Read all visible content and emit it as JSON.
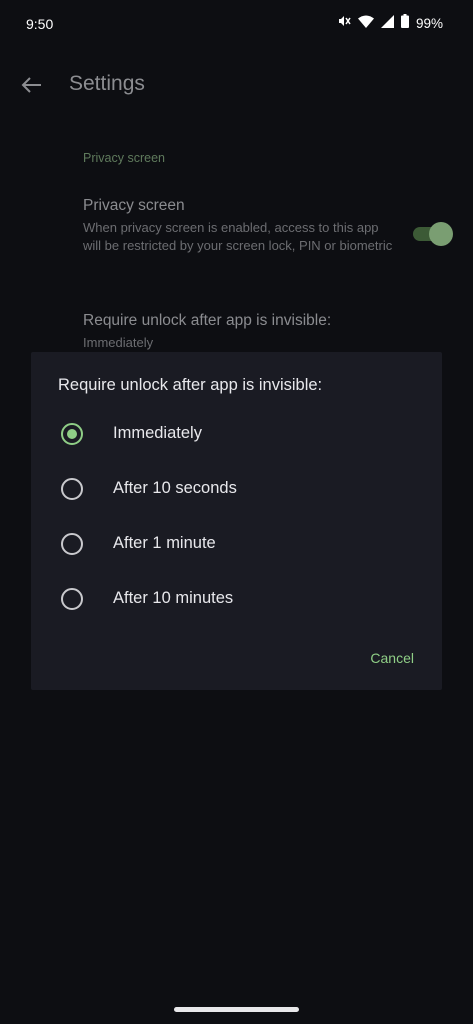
{
  "status_bar": {
    "time": "9:50",
    "battery": "99%",
    "icons": [
      "mute-icon",
      "wifi-icon",
      "signal-icon",
      "battery-icon"
    ]
  },
  "app_bar": {
    "title": "Settings",
    "back_icon": "arrow-back-icon"
  },
  "settings": {
    "section_header": "Privacy screen",
    "privacy_screen": {
      "title": "Privacy screen",
      "summary": "When privacy screen is enabled, access to this app will be restricted by your screen lock, PIN or biometric",
      "enabled": true
    },
    "require_unlock": {
      "title": "Require unlock after app is invisible:",
      "value": "Immediately"
    }
  },
  "dialog": {
    "title": "Require unlock after app is invisible:",
    "options": [
      {
        "label": "Immediately",
        "selected": true
      },
      {
        "label": "After 10 seconds",
        "selected": false
      },
      {
        "label": "After 1 minute",
        "selected": false
      },
      {
        "label": "After 10 minutes",
        "selected": false
      }
    ],
    "cancel_label": "Cancel"
  },
  "colors": {
    "background": "#0d0e12",
    "dialog": "#1a1b23",
    "accent": "#8fce86"
  }
}
